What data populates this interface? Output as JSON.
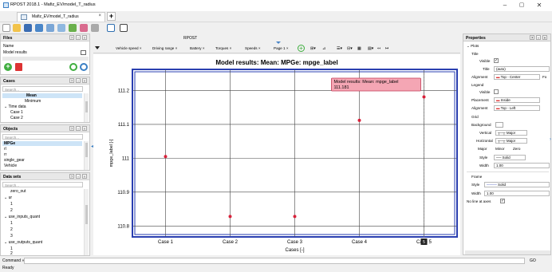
{
  "app": {
    "title": "RPOST 2018.1 - Mafiz_EV/model_T_radius",
    "minimize": "–",
    "maximize": "▢",
    "close": "✕"
  },
  "doc_tab": {
    "label": "Mafiz_EV/model_T_radius",
    "close": "×",
    "new_tab": "+"
  },
  "files_panel": {
    "title": "Files",
    "header_col": "Name",
    "item": "Model results"
  },
  "cases_panel": {
    "title": "Cases",
    "search_placeholder": "Search...",
    "items": [
      "Mean",
      "Minimum",
      "Time data",
      "Case 1",
      "Case 2"
    ]
  },
  "objects_panel": {
    "title": "Objects",
    "search_placeholder": "Search...",
    "items": [
      "MPGe",
      "rl",
      "rr",
      "single_gear",
      "Vehicle"
    ]
  },
  "datasets_panel": {
    "title": "Data sets",
    "search_placeholder": "Search...",
    "items": [
      "zero_out",
      "ur",
      "1",
      "2",
      "use_inputs_quant",
      "1",
      "2",
      "3",
      "use_outputs_quant",
      "1",
      "2"
    ]
  },
  "chart_window_label": "RPOST",
  "chart_tabs": [
    "Vehicle speed",
    "Driving range",
    "Battery",
    "Torques",
    "Speeds",
    "Page 1"
  ],
  "chart_data": {
    "type": "scatter",
    "title": "Model results: Mean: MPGe: mpge_label",
    "xlabel": "Cases [-]",
    "ylabel": "mpge_label [-]",
    "categories": [
      "Case 1",
      "Case 2",
      "Case 3",
      "Case 4",
      "Case 5"
    ],
    "values": [
      111.005,
      110.828,
      110.828,
      111.112,
      111.181
    ],
    "ylim": [
      110.77,
      111.26
    ],
    "yticks": [
      "111.2",
      "111.1",
      "111",
      "110.9",
      "110.8"
    ],
    "ytick_values": [
      111.2,
      111.1,
      111.0,
      110.9,
      110.8
    ],
    "grid": true,
    "marker_color": "#d9213a",
    "tooltip": {
      "title": "Model results: Mean: mpge_label",
      "value": "111.181"
    },
    "cursor_label": "5"
  },
  "properties": {
    "title": "Properties",
    "section_plots": "Plots",
    "title_group": "Title",
    "visible_label": "Visible",
    "title_label": "Title",
    "title_value": "(auto)",
    "alignment_label": "Alignment",
    "alignment_value": "Top - Center",
    "alignment_extra": "Fo",
    "legend_group": "Legend",
    "legend_visible": "Visible",
    "placement_label": "Placement",
    "placement_value": "Inside",
    "legend_alignment_label": "Alignment",
    "legend_alignment_value": "Top - Left",
    "grid_group": "Grid",
    "background_label": "Background",
    "vertical_label": "Vertical",
    "vertical_value": "Major",
    "horizontal_label": "Horizontal",
    "horizontal_value": "Major",
    "major_label": "Major",
    "minor_label": "Minor",
    "zero_label": "Zero",
    "style_label": "Style",
    "style_value": "Solid",
    "width_label": "Width",
    "width_value": "1.00",
    "frame_group": "Frame",
    "frame_style_label": "Style",
    "frame_style_value": "Solid",
    "frame_width_label": "Width",
    "frame_width_value": "1.00",
    "no_line_label": "No line at axes"
  },
  "command_label": "Command »",
  "go_label": "GO",
  "status_text": "Ready"
}
